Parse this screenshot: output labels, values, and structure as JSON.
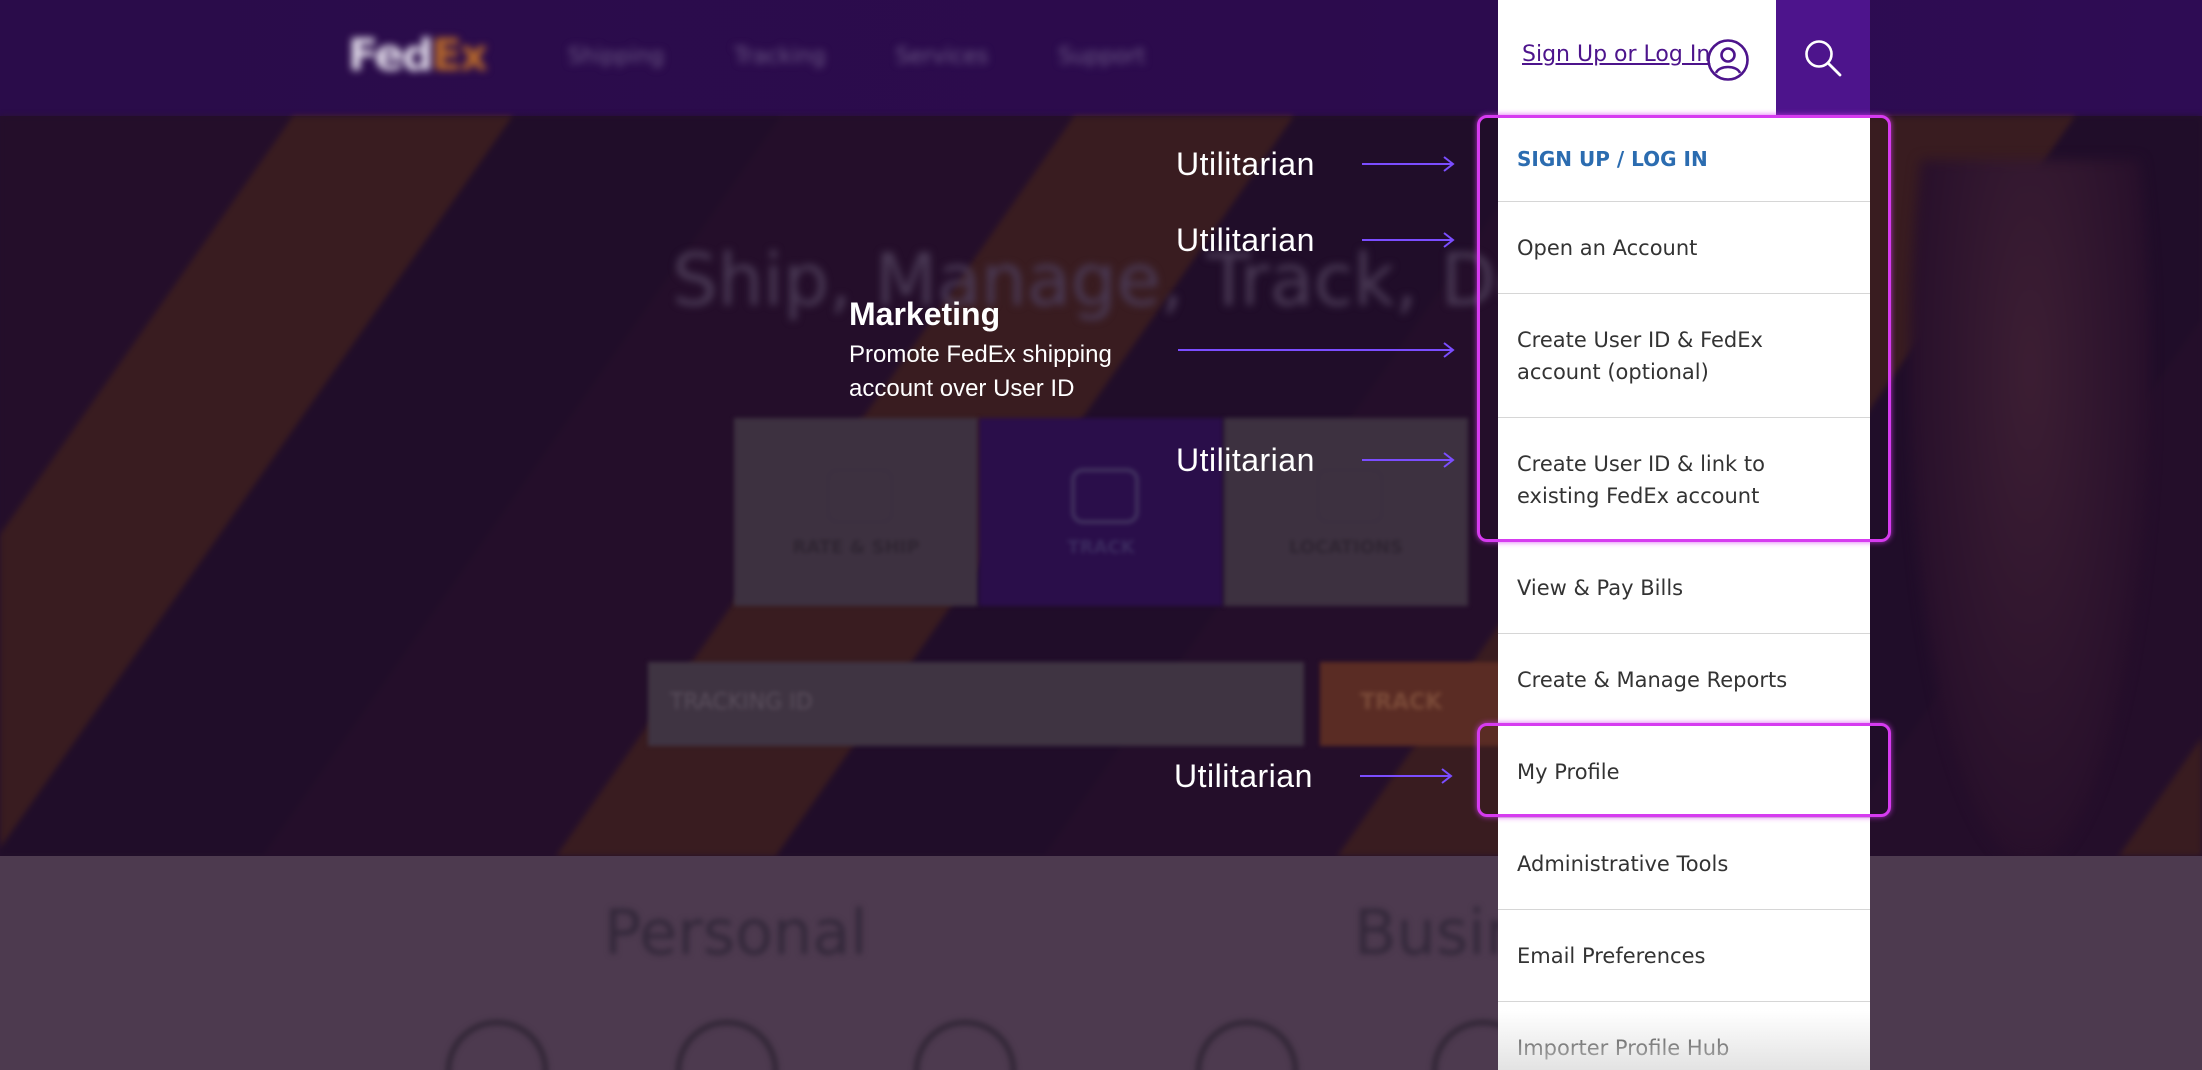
{
  "header": {
    "logo_fed": "Fed",
    "logo_ex": "Ex",
    "nav": [
      "Shipping",
      "Tracking",
      "Services",
      "Support"
    ],
    "signup_label": "Sign Up or Log In",
    "user_icon": "user-circle-icon",
    "search_icon": "search-icon"
  },
  "hero": {
    "headline": "Ship, Manage, Track, Deliver",
    "tiles": [
      "RATE & SHIP",
      "TRACK",
      "LOCATIONS"
    ],
    "tracking_placeholder": "TRACKING ID",
    "track_button": "TRACK"
  },
  "lower": {
    "personal": "Personal",
    "business": "Business"
  },
  "menu": {
    "items": [
      "SIGN UP / LOG IN",
      "Open an Account",
      "Create User ID & FedEx account (optional)",
      "Create User ID & link to existing FedEx account",
      "View & Pay Bills",
      "Create & Manage Reports",
      "My Profile",
      "Administrative Tools",
      "Email Preferences",
      "Importer Profile Hub"
    ]
  },
  "annotations": {
    "utilitarian": "Utilitarian",
    "marketing_title": "Marketing",
    "marketing_desc": "Promote FedEx shipping account over User ID"
  },
  "colors": {
    "brand_purple": "#4d148c",
    "brand_orange": "#ff6200",
    "highlight": "#d63bf0",
    "arrow": "#7b4dff",
    "primary_link": "#2b6cb0"
  }
}
